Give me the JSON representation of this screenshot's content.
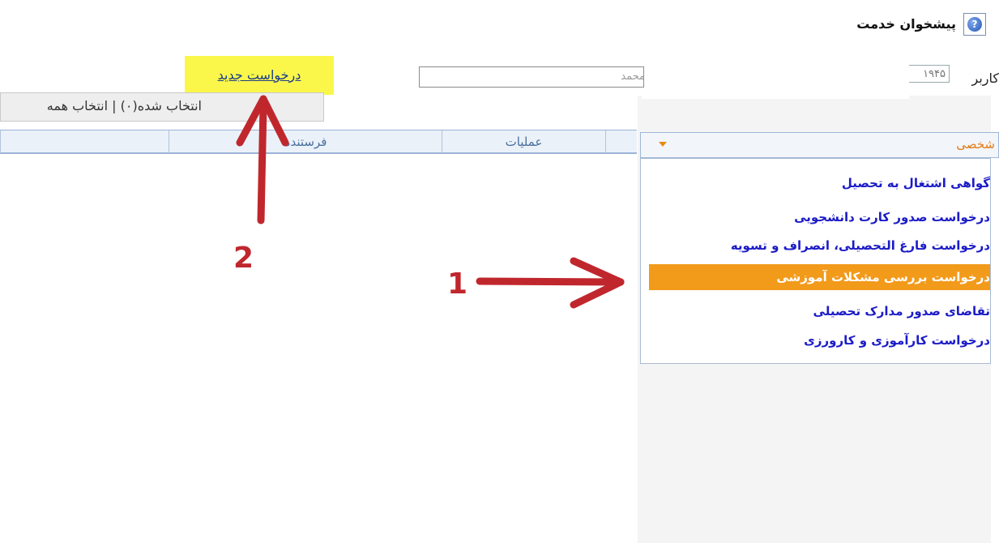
{
  "header": {
    "help_icon_glyph": "?",
    "title": "پیشخوان خدمت"
  },
  "user": {
    "label": "کاربر",
    "code": "۱۹۴۵",
    "name": "محمد"
  },
  "toolbar": {
    "new_request_label": "درخواست جدید",
    "selection_text": "انتخاب شده(۰) | انتخاب همه"
  },
  "table": {
    "columns": [
      "فرستنده",
      "عملیات"
    ]
  },
  "category": {
    "selected": "شخصی"
  },
  "menu": {
    "items": [
      {
        "label": "گواهی اشتغال به تحصیل",
        "active": false
      },
      {
        "label": "درخواست صدور کارت دانشجویی",
        "active": false
      },
      {
        "label": "درخواست فارغ التحصیلی، انصراف و تسویه",
        "active": false
      },
      {
        "label": "درخواست بررسی مشکلات آموزشی",
        "active": true
      },
      {
        "label": "تقاضای صدور مدارک تحصیلی",
        "active": false
      },
      {
        "label": "درخواست  کارآموزی و کارورزی",
        "active": false
      }
    ]
  },
  "annotations": {
    "arrow1_label": "1",
    "arrow2_label": "2",
    "arrow_color": "#c0272d",
    "highlight_color": "#fbf74a",
    "active_item_color": "#f29a1a"
  }
}
